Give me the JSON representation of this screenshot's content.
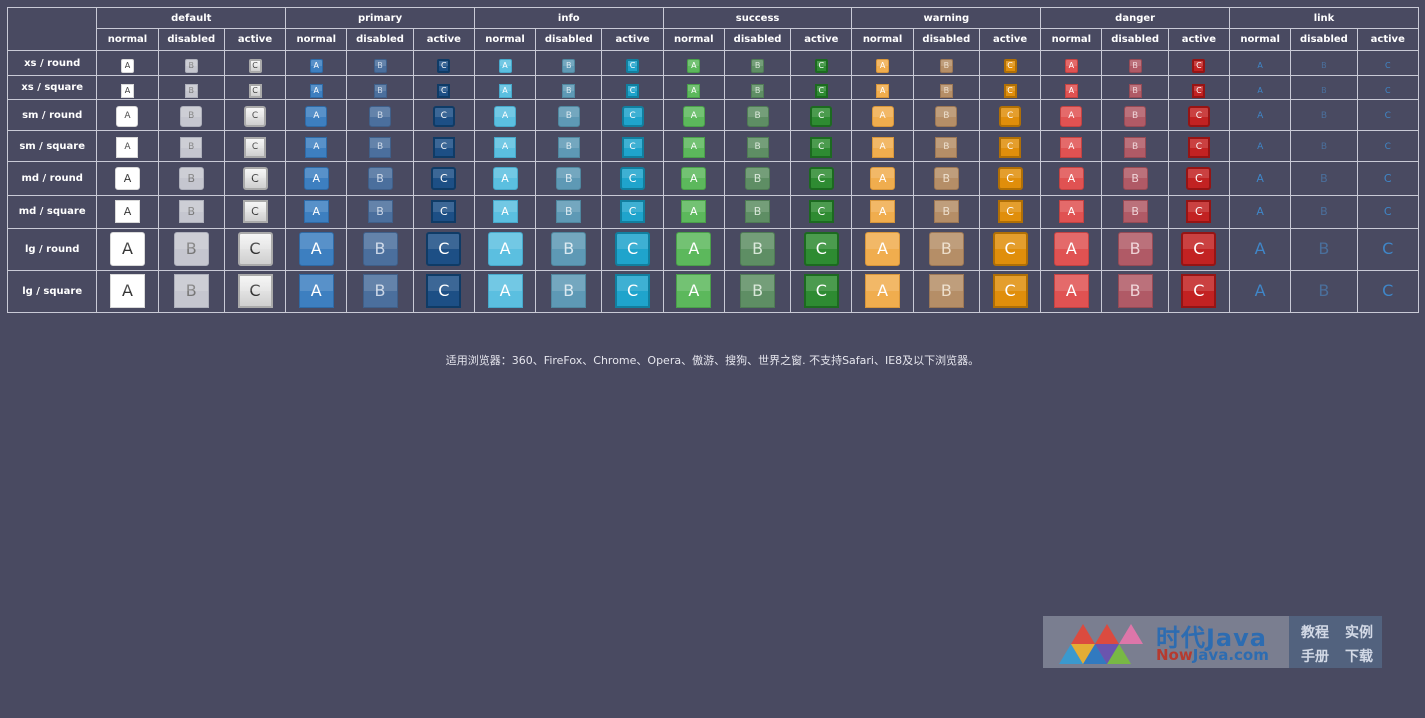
{
  "variants": [
    "default",
    "primary",
    "info",
    "success",
    "warning",
    "danger",
    "link"
  ],
  "states": [
    "normal",
    "disabled",
    "active"
  ],
  "rows": [
    {
      "label": "xs / round",
      "size": "xs",
      "shape": "round"
    },
    {
      "label": "xs / square",
      "size": "xs",
      "shape": "square"
    },
    {
      "label": "sm / round",
      "size": "sm",
      "shape": "round"
    },
    {
      "label": "sm / square",
      "size": "sm",
      "shape": "square"
    },
    {
      "label": "md / round",
      "size": "md",
      "shape": "round"
    },
    {
      "label": "md / square",
      "size": "md",
      "shape": "square"
    },
    {
      "label": "lg / round",
      "size": "lg",
      "shape": "round"
    },
    {
      "label": "lg / square",
      "size": "lg",
      "shape": "square"
    }
  ],
  "button_letters": {
    "normal": "A",
    "disabled": "B",
    "active": "C"
  },
  "note": "适用浏览器：360、FireFox、Chrome、Opera、傲游、搜狗、世界之窗. 不支持Safari、IE8及以下浏览器。",
  "watermark": {
    "title": "时代Java",
    "site_a": "Now",
    "site_b": "Java.com",
    "links": [
      "教程",
      "实例",
      "手册",
      "下载"
    ]
  },
  "colors": {
    "background": "#494a61",
    "border": "#c9cad6"
  }
}
